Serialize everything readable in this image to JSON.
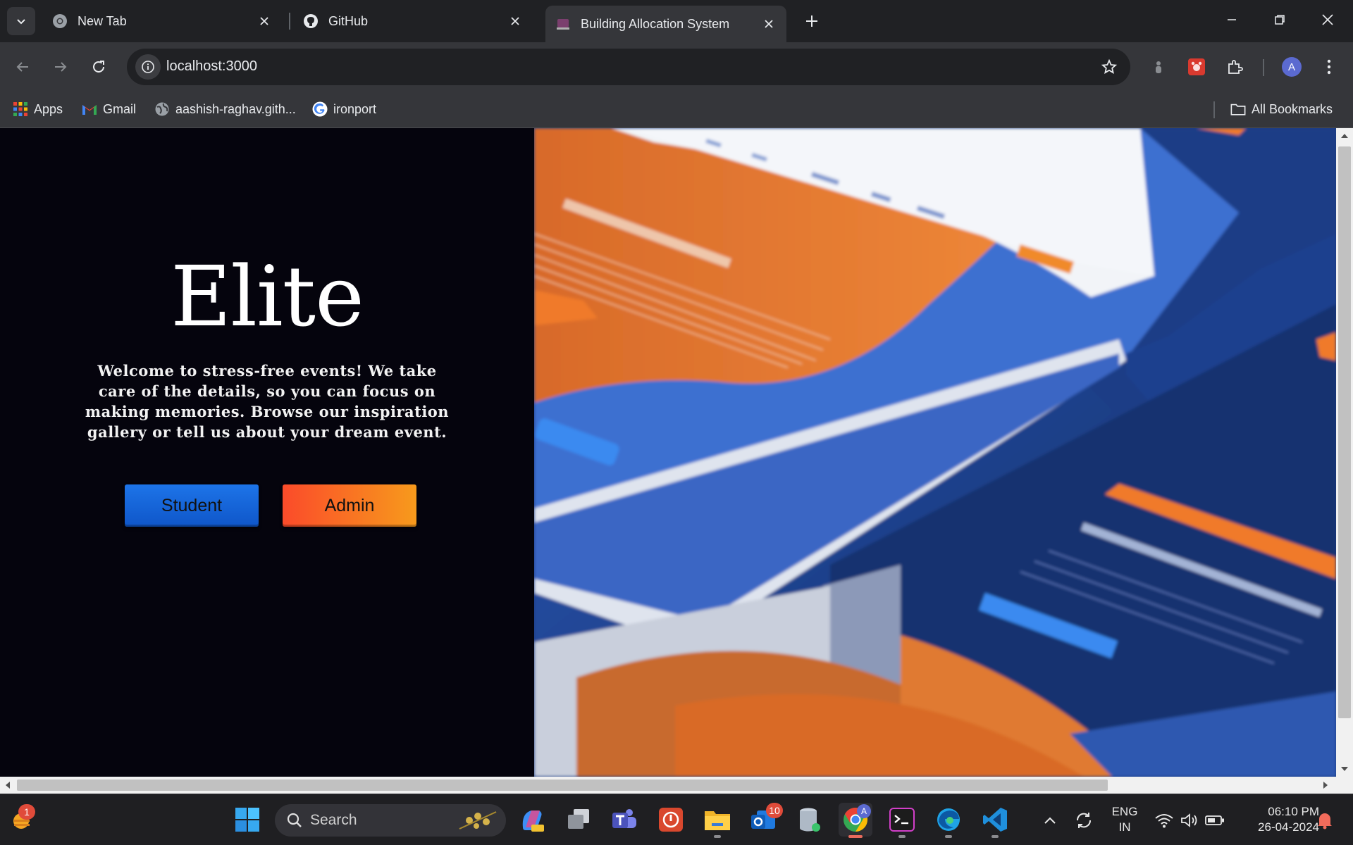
{
  "tabs": [
    {
      "title": "New Tab",
      "icon": "chrome-icon"
    },
    {
      "title": "GitHub",
      "icon": "github-icon"
    },
    {
      "title": "Building Allocation System",
      "icon": "site-icon",
      "active": true
    }
  ],
  "toolbar": {
    "url": "localhost:3000",
    "profile_initial": "A"
  },
  "bookmarks": {
    "items": [
      {
        "label": "Apps",
        "icon": "apps-grid-icon"
      },
      {
        "label": "Gmail",
        "icon": "gmail-icon"
      },
      {
        "label": "aashish-raghav.gith...",
        "icon": "globe-icon"
      },
      {
        "label": "ironport",
        "icon": "google-icon"
      }
    ],
    "all_bookmarks": "All Bookmarks"
  },
  "page": {
    "brand": "Elite",
    "tagline": "Welcome to stress-free events! We take care of the details, so you can focus on making memories. Browse our inspiration gallery or tell us about your dream event.",
    "buttons": {
      "student": "Student",
      "admin": "Admin"
    }
  },
  "taskbar": {
    "search_placeholder": "Search",
    "weather_badge": "1",
    "outlook_badge": "10",
    "chrome_profile": "A",
    "language": [
      "ENG",
      "IN"
    ],
    "time": "06:10 PM",
    "date": "26-04-2024"
  },
  "colors": {
    "student_button": "#1d74e8",
    "admin_button_start": "#fb4b2a",
    "admin_button_end": "#f79a1c",
    "page_background": "#05040d"
  }
}
